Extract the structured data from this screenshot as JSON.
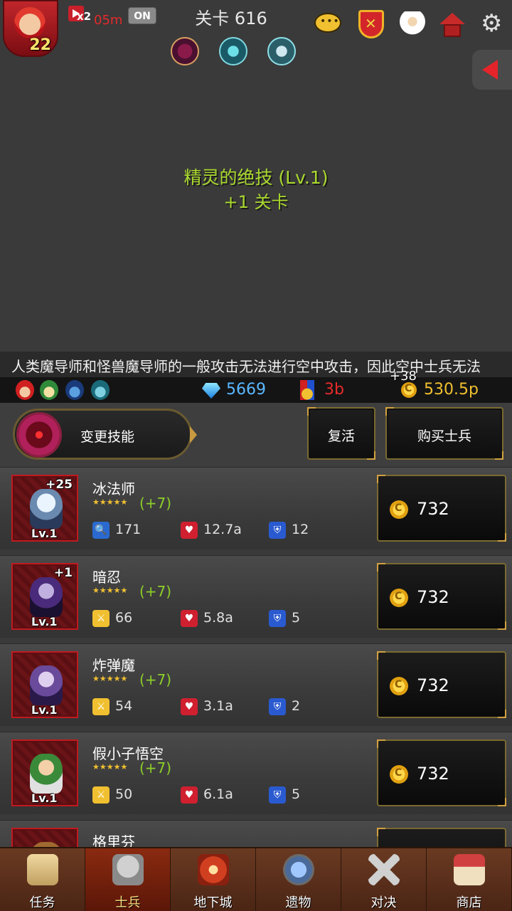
{
  "hud": {
    "player_level": "22",
    "speed_multiplier": "x2",
    "speed_time": "05m",
    "auto_toggle": "ON",
    "stage_label": "关卡 616"
  },
  "skill_message": {
    "line1": "精灵的绝技 (Lv.1)",
    "line2": "+1 关卡"
  },
  "ticker": "人类魔导师和怪兽魔导师的一般攻击无法进行空中攻击，因此空中士兵无法",
  "floating_gain": "+38",
  "resources": {
    "gems": "5669",
    "medals": "3b",
    "gold": "530.5p"
  },
  "actions": {
    "change_skill": "变更技能",
    "revive": "复活",
    "buy_soldier": "购买士兵"
  },
  "soldiers": [
    {
      "name": "冰法师",
      "plus": "+25",
      "level": "Lv.1",
      "stars": "★★★★★",
      "bonus": "(+7)",
      "attack": "171",
      "hp": "12.7a",
      "defense": "12",
      "price": "732"
    },
    {
      "name": "暗忍",
      "plus": "+1",
      "level": "Lv.1",
      "stars": "★★★★★",
      "bonus": "(+7)",
      "attack": "66",
      "hp": "5.8a",
      "defense": "5",
      "price": "732"
    },
    {
      "name": "炸弹魔",
      "plus": "",
      "level": "Lv.1",
      "stars": "★★★★★",
      "bonus": "(+7)",
      "attack": "54",
      "hp": "3.1a",
      "defense": "2",
      "price": "732"
    },
    {
      "name": "假小子悟空",
      "plus": "",
      "level": "Lv.1",
      "stars": "★★★★★",
      "bonus": "(+7)",
      "attack": "50",
      "hp": "6.1a",
      "defense": "5",
      "price": "732"
    },
    {
      "name": "格里芬"
    }
  ],
  "nav": [
    {
      "label": "任务",
      "icon": "scroll-icon"
    },
    {
      "label": "士兵",
      "icon": "helmet-icon"
    },
    {
      "label": "地下城",
      "icon": "monster-icon"
    },
    {
      "label": "遗物",
      "icon": "orb-icon"
    },
    {
      "label": "对决",
      "icon": "crossed-swords-icon"
    },
    {
      "label": "商店",
      "icon": "shop-icon"
    }
  ],
  "colors": {
    "background": "#3a3a3a",
    "accent_green": "#a9d82e",
    "gem_blue": "#5ab8ff",
    "gold": "#f0c030",
    "red": "#e32a2a"
  }
}
